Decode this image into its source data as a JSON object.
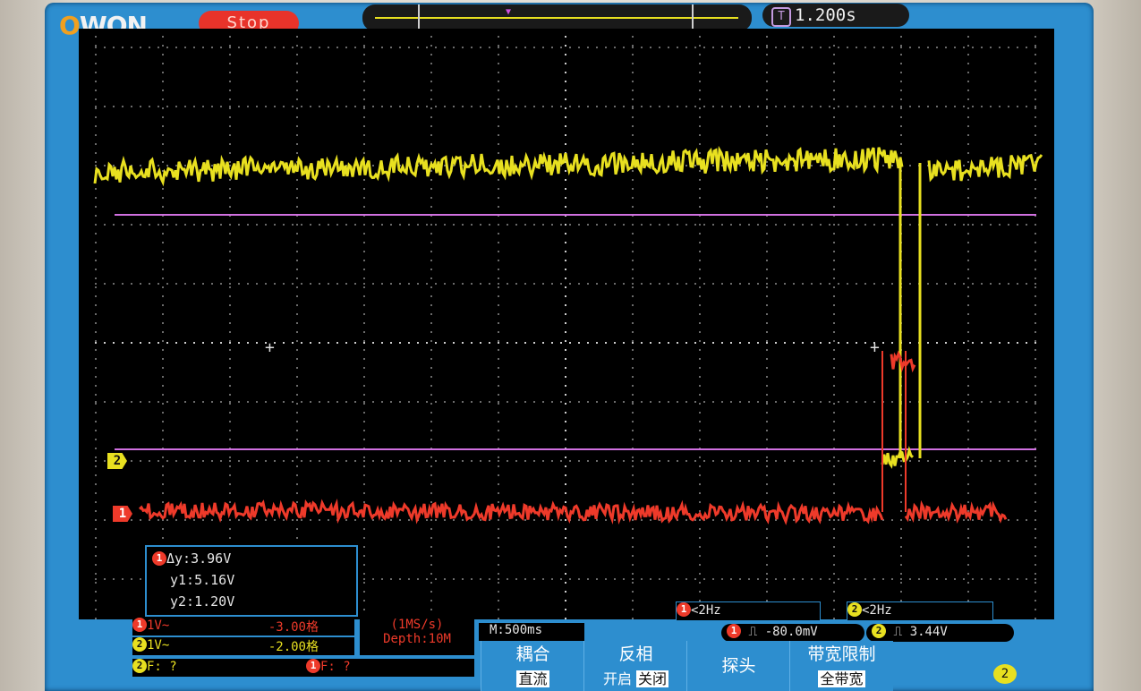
{
  "header": {
    "brand": "OWON",
    "run_state": "Stop",
    "trigger_time": "1.200s",
    "trigger_time_icon": "T"
  },
  "channels": {
    "ch1_marker": "1",
    "ch2_marker": "2",
    "ch1_color": "#ee3a2a",
    "ch2_color": "#e8e020",
    "cursor_color": "#d070e0"
  },
  "cursors": {
    "delta": "Δy:3.96V",
    "y1": "y1:5.16V",
    "y2": "y2:1.20V"
  },
  "status": {
    "ch1_scale": "1V~",
    "ch1_offset": "-3.00格",
    "ch2_scale": "1V~",
    "ch2_offset": "-2.00格",
    "sample_rate": "(1MS/s)",
    "depth": "Depth:10M",
    "timebase": "M:500ms",
    "ch2_freq": "F: ?",
    "ch1_freq": "F: ?",
    "ch1_counter": "<2Hz",
    "ch2_counter": "<2Hz",
    "ch1_trigger": "-80.0mV",
    "ch2_trigger": "3.44V"
  },
  "menu": [
    {
      "title": "耦合",
      "value": "直流"
    },
    {
      "title": "反相",
      "value_a": "开启",
      "value_b": "关闭"
    },
    {
      "title": "探头",
      "value": ""
    },
    {
      "title": "带宽限制",
      "value": "全带宽"
    }
  ],
  "menu_page": "2"
}
